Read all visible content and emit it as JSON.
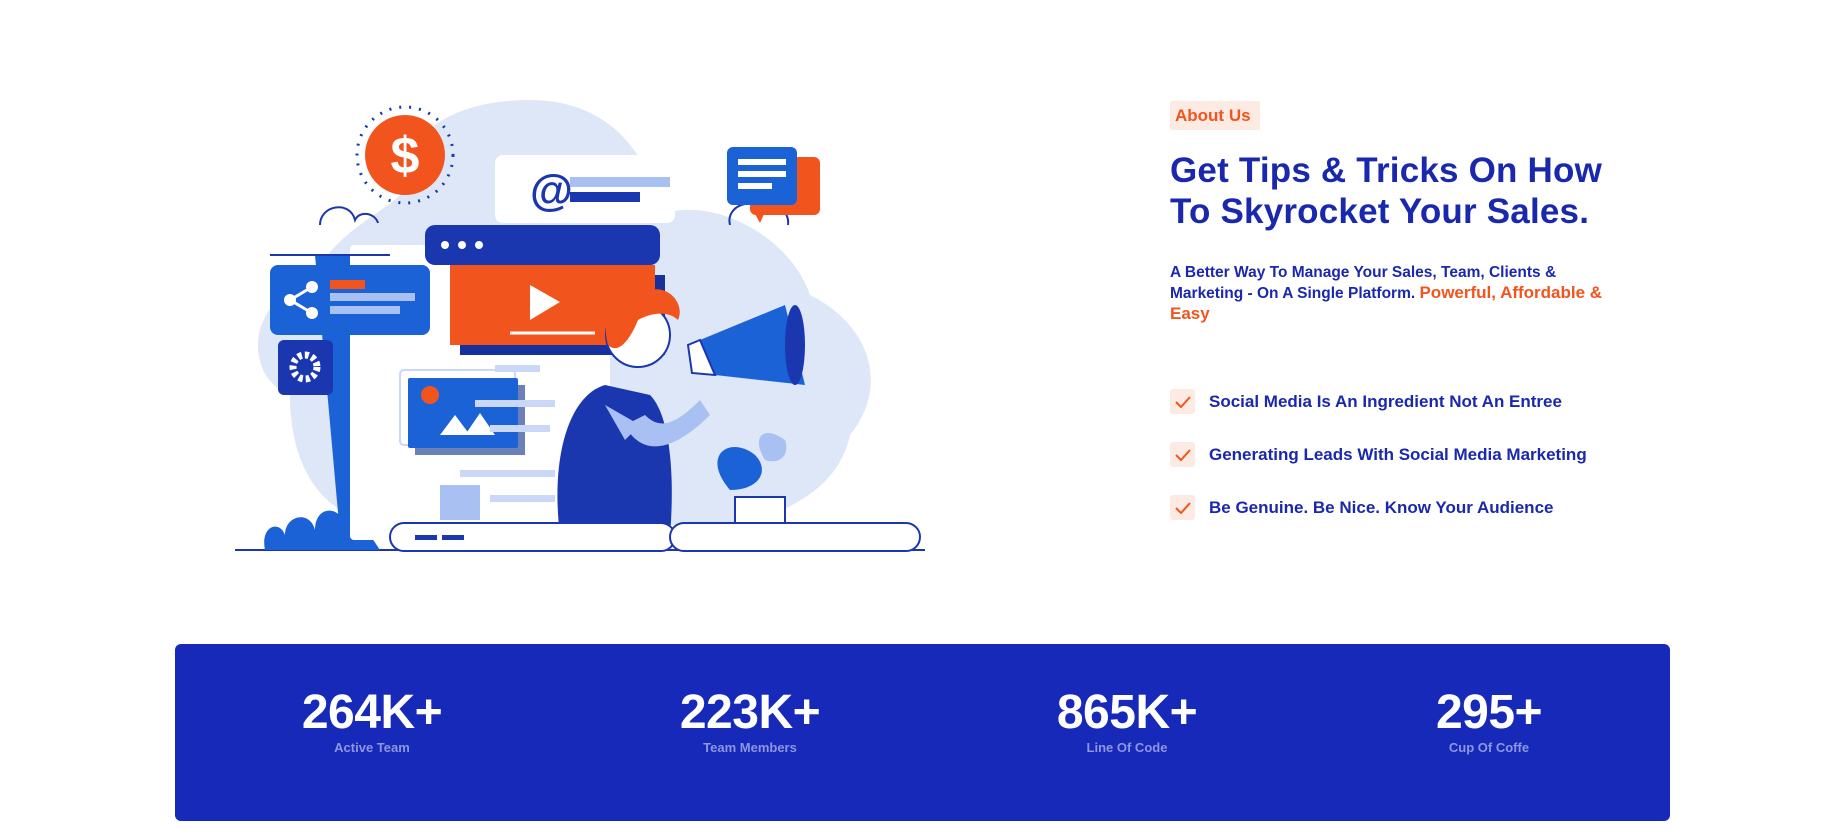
{
  "about": {
    "badge": "About Us",
    "heading": "Get Tips & Tricks On How To Skyrocket Your Sales.",
    "description": "A Better Way To Manage Your Sales, Team, Clients & Marketing - On A Single Platform.",
    "description_accent": "Powerful, Affordable & Easy",
    "features": [
      {
        "icon": "check-icon",
        "label": "Social Media Is An Ingredient Not An Entree"
      },
      {
        "icon": "check-icon",
        "label": "Generating Leads With Social Media Marketing"
      },
      {
        "icon": "check-icon",
        "label": "Be Genuine. Be Nice. Know Your Audience"
      }
    ]
  },
  "stats": [
    {
      "value": "264K+",
      "label": "Active Team"
    },
    {
      "value": "223K+",
      "label": "Team Members"
    },
    {
      "value": "865K+",
      "label": "Line Of Code"
    },
    {
      "value": "295+",
      "label": "Cup Of Coffe"
    }
  ],
  "illustration": {
    "subject": "marketing-illustration",
    "dollar_symbol": "$",
    "at_symbol": "@"
  },
  "colors": {
    "primary": "#1729b9",
    "accent": "#f2541d",
    "accent_light": "#fdeae3",
    "illustration_light": "#dde7f8"
  }
}
